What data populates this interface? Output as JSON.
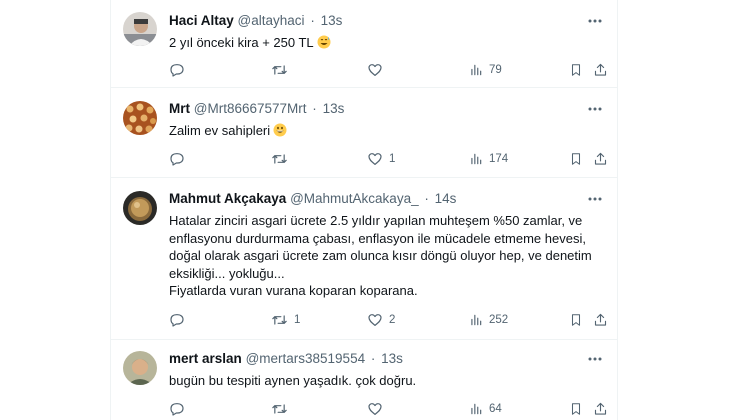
{
  "tweets": [
    {
      "name": "Haci Altay",
      "handle": "@altayhaci",
      "separator": "·",
      "time": "13s",
      "text_lines": [
        "2 yıl önceki kira + 250 TL"
      ],
      "emoji": "sweat-smile",
      "reply_count": "",
      "retweet_count": "",
      "like_count": "",
      "views": "79"
    },
    {
      "name": "Mrt",
      "handle": "@Mrt86667577Mrt",
      "separator": "·",
      "time": "13s",
      "text_lines": [
        "Zalim ev sahipleri"
      ],
      "emoji": "grin",
      "reply_count": "",
      "retweet_count": "",
      "like_count": "1",
      "views": "174"
    },
    {
      "name": "Mahmut Akçakaya",
      "handle": "@MahmutAkcakaya_",
      "separator": "·",
      "time": "14s",
      "text_lines": [
        "Hatalar zinciri asgari ücrete 2.5 yıldır yapılan muhteşem %50 zamlar, ve",
        "enflasyonu durdurmama çabası, enflasyon ile mücadele etmeme hevesi,",
        "doğal olarak asgari ücrete zam olunca kısır döngü oluyor hep, ve denetim",
        "eksikliği... yokluğu...",
        "Fiyatlarda vuran vurana koparan koparana."
      ],
      "emoji": "",
      "reply_count": "",
      "retweet_count": "1",
      "like_count": "2",
      "views": "252"
    },
    {
      "name": "mert arslan",
      "handle": "@mertars38519554",
      "separator": "·",
      "time": "13s",
      "text_lines": [
        "bugün bu tespiti aynen yaşadık. çok doğru."
      ],
      "emoji": "",
      "reply_count": "",
      "retweet_count": "",
      "like_count": "",
      "views": "64"
    }
  ],
  "icons": {
    "reply": "reply-icon",
    "retweet": "retweet-icon",
    "like": "like-icon",
    "views": "views-icon",
    "bookmark": "bookmark-icon",
    "share": "share-icon",
    "more": "more-icon"
  },
  "colors": {
    "text": "#0f1419",
    "secondary": "#536471",
    "divider": "#eff3f4",
    "emoji": "#ffcc4d"
  }
}
